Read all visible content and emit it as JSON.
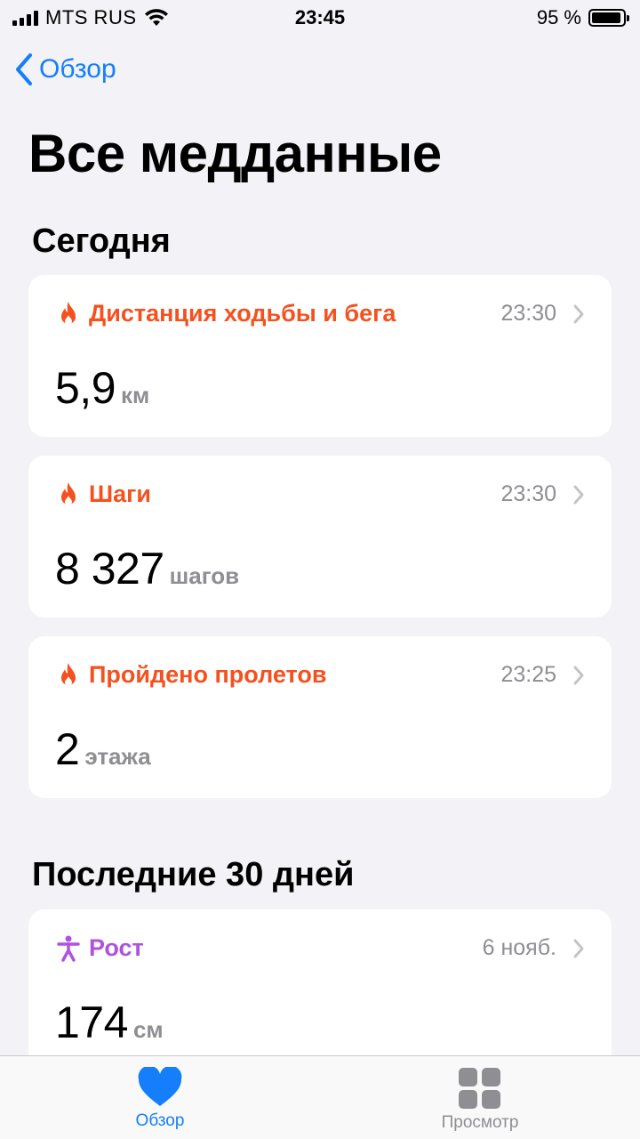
{
  "status_bar": {
    "carrier": "MTS RUS",
    "time": "23:45",
    "battery_percent": "95 %",
    "battery_level": 0.95
  },
  "nav": {
    "back_label": "Обзор"
  },
  "page_title": "Все медданные",
  "sections": [
    {
      "title": "Сегодня"
    },
    {
      "title": "Последние 30 дней"
    }
  ],
  "cards": [
    {
      "label": "Дистанция ходьбы и бега",
      "time": "23:30",
      "value": "5,9",
      "unit": "км",
      "color": "#f4511e",
      "icon": "flame-icon"
    },
    {
      "label": "Шаги",
      "time": "23:30",
      "value": "8 327",
      "unit": "шагов",
      "color": "#f4511e",
      "icon": "flame-icon"
    },
    {
      "label": "Пройдено пролетов",
      "time": "23:25",
      "value": "2",
      "unit": "этажа",
      "color": "#f4511e",
      "icon": "flame-icon"
    },
    {
      "label": "Рост",
      "time": "6 нояб.",
      "value": "174",
      "unit": "см",
      "color": "#af52de",
      "icon": "person-icon"
    }
  ],
  "tab_bar": {
    "tabs": [
      {
        "label": "Обзор",
        "icon": "heart-icon",
        "active": true
      },
      {
        "label": "Просмотр",
        "icon": "grid-icon",
        "active": false
      }
    ]
  },
  "colors": {
    "accent": "#147efb",
    "activity": "#f4511e",
    "body": "#af52de",
    "secondary": "#8e8e93"
  }
}
